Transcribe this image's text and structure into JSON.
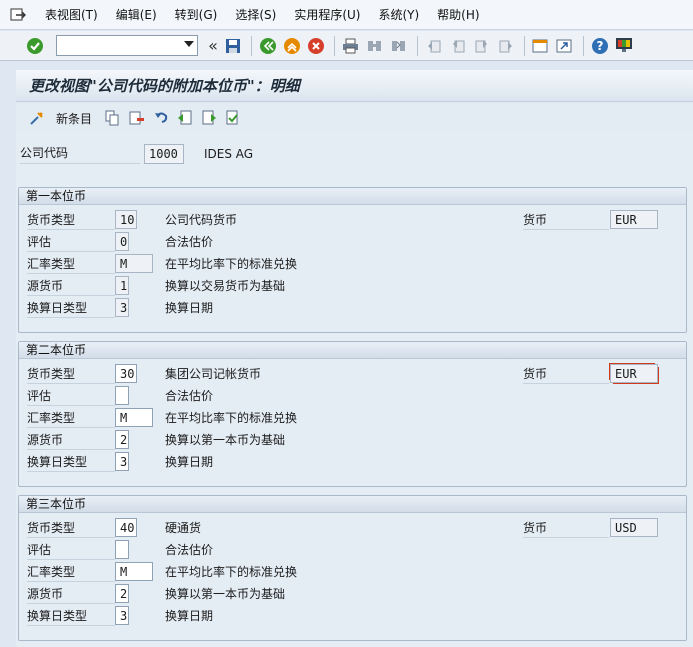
{
  "menu": {
    "items": [
      "表视图(T)",
      "编辑(E)",
      "转到(G)",
      "选择(S)",
      "实用程序(U)",
      "系统(Y)",
      "帮助(H)"
    ]
  },
  "toolbar": {
    "command_value": "",
    "icons": [
      "enter-icon",
      "save-icon",
      "back-icon",
      "exit-icon",
      "cancel-icon",
      "print-icon",
      "find-icon",
      "find-next-icon",
      "first-page-icon",
      "previous-page-icon",
      "next-page-icon",
      "last-page-icon",
      "new-session-icon",
      "shortcut-icon",
      "help-icon",
      "customize-layout-icon"
    ]
  },
  "title": "更改视图\"公司代码的附加本位币\"：明细",
  "app_toolbar": {
    "new_entries_label": "新条目"
  },
  "company": {
    "label": "公司代码",
    "code": "1000",
    "name": "IDES AG"
  },
  "groups": [
    {
      "title": "第一本位币",
      "currency_type_label": "货币类型",
      "currency_type": "10",
      "currency_type_desc": "公司代码货币",
      "valuation_label": "评估",
      "valuation": "0",
      "valuation_desc": "合法估价",
      "exrate_label": "汇率类型",
      "exrate": "M",
      "exrate_desc": "在平均比率下的标准兑换",
      "source_label": "源货币",
      "source": "1",
      "source_desc": "换算以交易货币为基础",
      "trdate_label": "换算日类型",
      "trdate": "3",
      "trdate_desc": "换算日期",
      "currency_label": "货币",
      "currency": "EUR"
    },
    {
      "title": "第二本位币",
      "currency_type_label": "货币类型",
      "currency_type": "30",
      "currency_type_desc": "集团公司记帐货币",
      "valuation_label": "评估",
      "valuation": "",
      "valuation_desc": "合法估价",
      "exrate_label": "汇率类型",
      "exrate": "M",
      "exrate_desc": "在平均比率下的标准兑换",
      "source_label": "源货币",
      "source": "2",
      "source_desc": "换算以第一本币为基础",
      "trdate_label": "换算日类型",
      "trdate": "3",
      "trdate_desc": "换算日期",
      "currency_label": "货币",
      "currency": "EUR"
    },
    {
      "title": "第三本位币",
      "currency_type_label": "货币类型",
      "currency_type": "40",
      "currency_type_desc": "硬通货",
      "valuation_label": "评估",
      "valuation": "",
      "valuation_desc": "合法估价",
      "exrate_label": "汇率类型",
      "exrate": "M",
      "exrate_desc": "在平均比率下的标准兑换",
      "source_label": "源货币",
      "source": "2",
      "source_desc": "换算以第一本币为基础",
      "trdate_label": "换算日类型",
      "trdate": "3",
      "trdate_desc": "换算日期",
      "currency_label": "货币",
      "currency": "USD"
    }
  ],
  "colors": {
    "accent_green": "#3a9a2c",
    "accent_orange": "#e58a00",
    "accent_red": "#d6402a",
    "focus_red": "#d13a1a"
  }
}
